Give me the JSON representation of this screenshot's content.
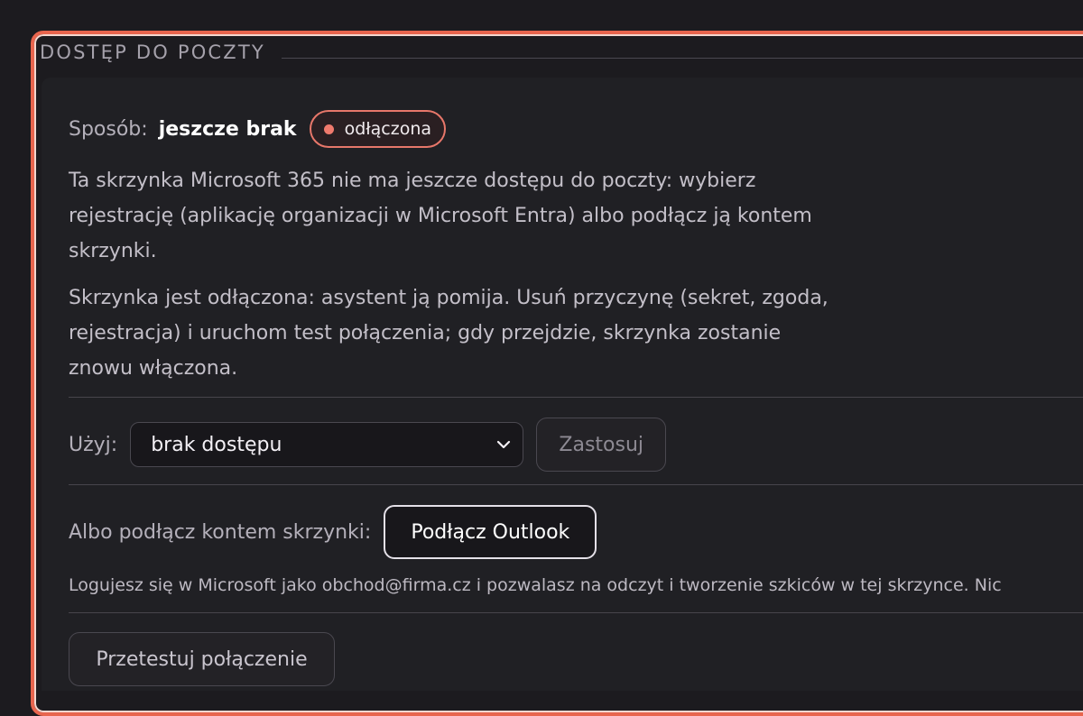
{
  "section": {
    "title": "DOSTĘP DO POCZTY"
  },
  "method": {
    "label": "Sposób:",
    "value": "jeszcze brak",
    "badge": "odłączona"
  },
  "description": {
    "paragraph1": "Ta skrzynka Microsoft 365 nie ma jeszcze dostępu do poczty: wybierz rejestrację (aplikację organizacji w Microsoft Entra) albo podłącz ją kontem skrzynki.",
    "paragraph2": "Skrzynka jest odłączona: asystent ją pomija. Usuń przyczynę (sekret, zgoda, rejestracja) i uruchom test połączenia; gdy przejdzie, skrzynka zostanie znowu włączona."
  },
  "use": {
    "label": "Użyj:",
    "selected": "brak dostępu",
    "apply_label": "Zastosuj"
  },
  "connect": {
    "label": "Albo podłącz kontem skrzynki:",
    "button_label": "Podłącz Outlook",
    "hint": "Logujesz się w Microsoft jako obchod@firma.cz i pozwalasz na odczyt i tworzenie szkiców w tej skrzynce. Nic"
  },
  "test": {
    "button_label": "Przetestuj połączenie"
  },
  "colors": {
    "accent_border": "#e8654e",
    "badge_dot": "#f07a6d",
    "background": "#1c1b1f"
  },
  "icons": {
    "select_chevron": "chevron-down-icon",
    "status_dot": "status-dot-icon"
  }
}
